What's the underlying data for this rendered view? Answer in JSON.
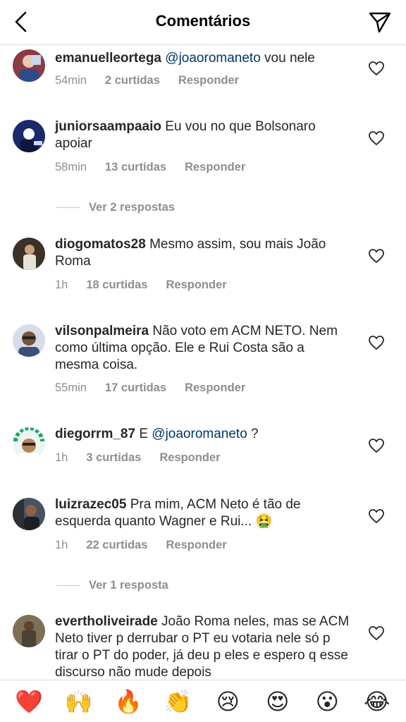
{
  "header": {
    "title": "Comentários"
  },
  "comments": [
    {
      "user": "emanuelleortega",
      "mention": "@joaoromaneto",
      "text": " vou nele",
      "time": "54min",
      "likes": "2 curtidas",
      "reply": "Responder"
    },
    {
      "user": "juniorsaampaaio",
      "text": "Eu vou no que Bolsonaro apoiar",
      "time": "58min",
      "likes": "13 curtidas",
      "reply": "Responder"
    },
    {
      "user": "diogomatos28",
      "text": "Mesmo assim, sou mais João Roma",
      "time": "1h",
      "likes": "18 curtidas",
      "reply": "Responder"
    },
    {
      "user": "vilsonpalmeira",
      "text": "Não voto em ACM NETO. Nem como última opção. Ele e Rui Costa são a mesma coisa.",
      "time": "55min",
      "likes": "17 curtidas",
      "reply": "Responder"
    },
    {
      "user": "diegorrm_87",
      "text_before": "E ",
      "mention": "@joaoromaneto",
      "text": " ?",
      "time": "1h",
      "likes": "3 curtidas",
      "reply": "Responder"
    },
    {
      "user": "luizrazec05",
      "text": "Pra mim, ACM Neto é tão de esquerda quanto Wagner e Rui... 🤮",
      "time": "1h",
      "likes": "22 curtidas",
      "reply": "Responder"
    },
    {
      "user": "evertholiveirade",
      "text": "João Roma neles, mas se ACM Neto tiver p derrubar o PT eu votaria nele só p tirar o PT do poder, já deu p eles e espero q esse discurso não mude depois"
    }
  ],
  "view_replies": [
    "Ver 2 respostas",
    "Ver 1 resposta"
  ],
  "emoji_bar": [
    "❤️",
    "🙌",
    "🔥",
    "👏",
    "😢",
    "😍",
    "😮",
    "😂"
  ]
}
